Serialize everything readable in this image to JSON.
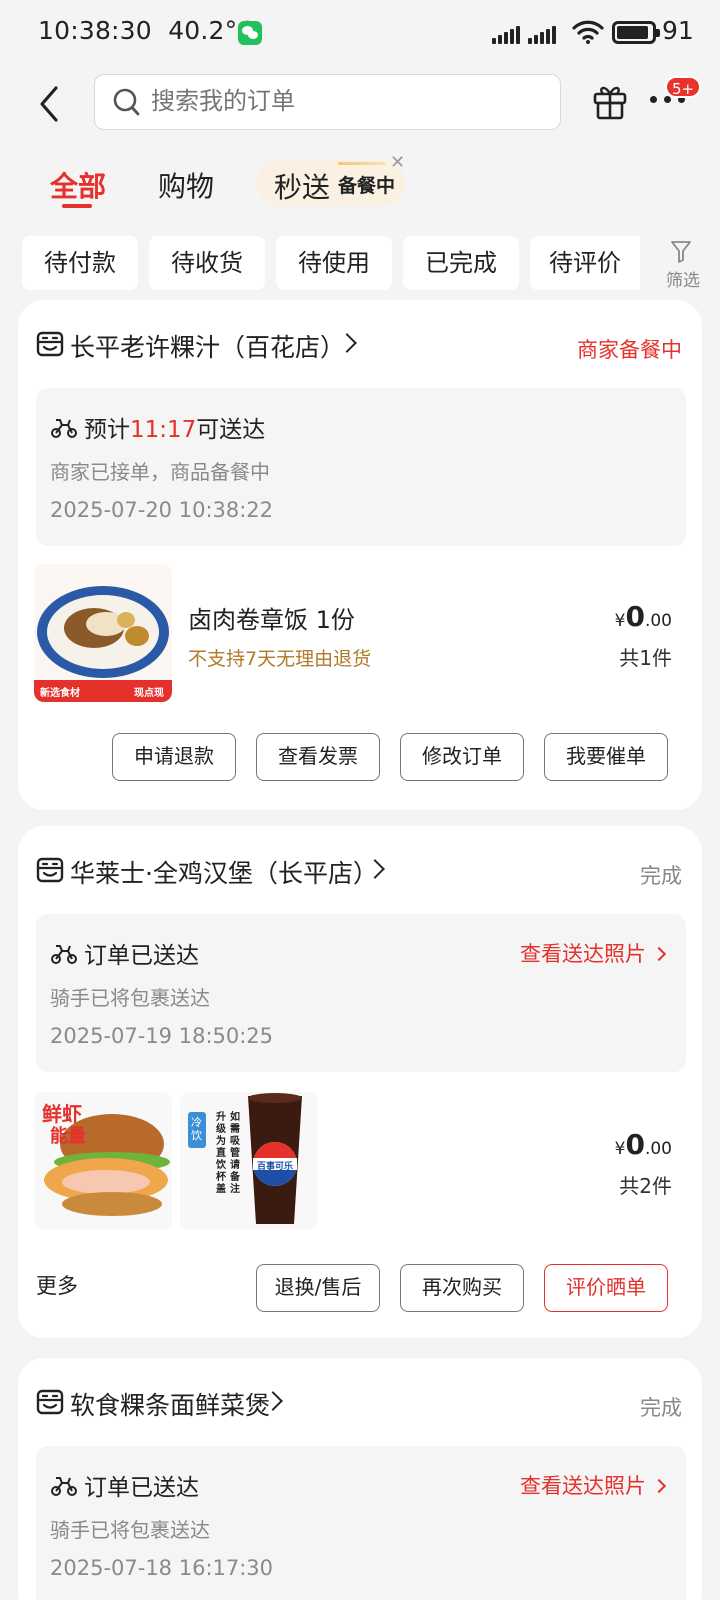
{
  "status_bar": {
    "time": "10:38:30",
    "temperature": "40.2°C",
    "battery": "91",
    "battery_level": 0.91
  },
  "header": {
    "search_placeholder": "搜索我的订单",
    "notification_badge": "5+"
  },
  "tabs": [
    {
      "label": "全部",
      "active": true
    },
    {
      "label": "购物",
      "active": false
    },
    {
      "label": "秒送",
      "sub": "备餐中",
      "active": false
    }
  ],
  "filters": [
    "待付款",
    "待收货",
    "待使用",
    "已完成",
    "待评价"
  ],
  "filter_label": "筛选",
  "orders": [
    {
      "shop": "长平老许粿汁（百花店）",
      "status": "商家备餐中",
      "info_prefix": "预计",
      "info_highlight": "11:17",
      "info_suffix": "可送达",
      "desc": "商家已接单，商品备餐中",
      "time": "2025-07-20 10:38:22",
      "item_name": "卤肉卷章饭 1份",
      "item_note": "不支持7天无理由退货",
      "thumb_tags": [
        "新选食材",
        "现点现做"
      ],
      "price_symbol": "¥",
      "price_int": "0",
      "price_dec": ".00",
      "qty": "共1件",
      "buttons": [
        "申请退款",
        "查看发票",
        "修改订单",
        "我要催单"
      ]
    },
    {
      "shop": "华莱士·全鸡汉堡（长平店）",
      "status": "完成",
      "info_title": "订单已送达",
      "photo_link": "查看送达照片",
      "desc": "骑手已将包裹送达",
      "time": "2025-07-19 18:50:25",
      "thumb_texts": [
        "鲜虾",
        "能量",
        "冷饮",
        "升级为直饮杯盖",
        "如需吸管请备注",
        "百事可乐"
      ],
      "price_symbol": "¥",
      "price_int": "0",
      "price_dec": ".00",
      "qty": "共2件",
      "more": "更多",
      "buttons": [
        "退换/售后",
        "再次购买",
        "评价晒单"
      ]
    },
    {
      "shop": "软食粿条面鲜菜煲",
      "status": "完成",
      "info_title": "订单已送达",
      "photo_link": "查看送达照片",
      "desc": "骑手已将包裹送达",
      "time": "2025-07-18 16:17:30"
    }
  ],
  "colors": {
    "accent": "#e4312c",
    "background": "#f4f4f4",
    "card": "#ffffff",
    "note": "#b07a2a"
  },
  "icons": [
    "back-arrow-icon",
    "search-icon",
    "gift-icon",
    "more-icon",
    "filter-icon",
    "shop-icon",
    "rider-icon",
    "chevron-right-icon",
    "wechat-icon",
    "signal-icon",
    "wifi-icon",
    "battery-icon"
  ]
}
